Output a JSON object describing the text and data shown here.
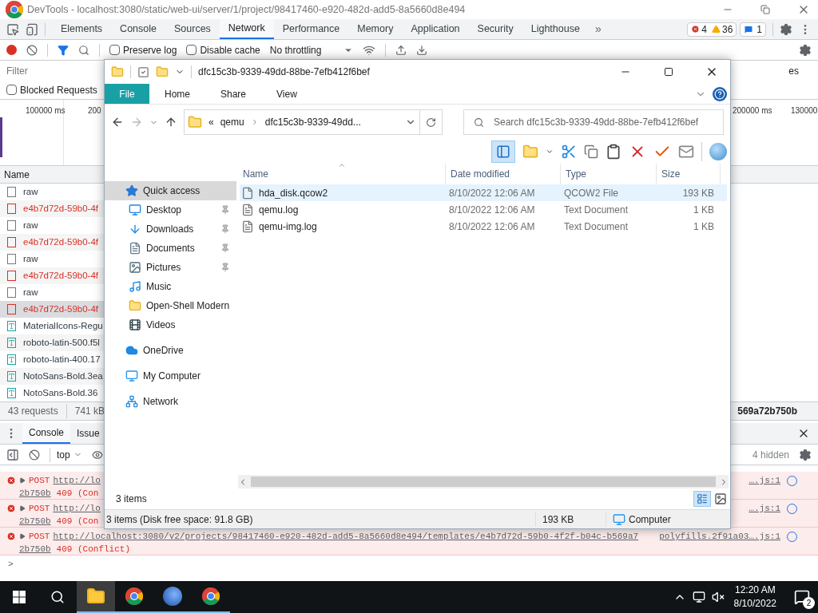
{
  "devtools": {
    "title": "DevTools - localhost:3080/static/web-ui/server/1/project/98417460-e920-482d-add5-8a5660d8e494",
    "tabs": [
      {
        "label": "Elements",
        "selected": false
      },
      {
        "label": "Console",
        "selected": false
      },
      {
        "label": "Sources",
        "selected": false
      },
      {
        "label": "Network",
        "selected": true
      },
      {
        "label": "Performance",
        "selected": false
      },
      {
        "label": "Memory",
        "selected": false
      },
      {
        "label": "Application",
        "selected": false
      },
      {
        "label": "Security",
        "selected": false
      },
      {
        "label": "Lighthouse",
        "selected": false
      }
    ],
    "more_tabs": "»",
    "badges": {
      "errors": "4",
      "warnings": "36",
      "messages": "1"
    },
    "recording": true,
    "preserve_log": {
      "label": "Preserve log",
      "checked": false
    },
    "disable_cache": {
      "label": "Disable cache",
      "checked": false
    },
    "throttling": "No throttling",
    "filter": {
      "placeholder": "Filter"
    },
    "filter_right": "es",
    "blocked_requests": {
      "label": "Blocked Requests",
      "checked": false
    },
    "timeline_ticks": [
      "100000 ms",
      "200",
      "200000 ms",
      "130000"
    ],
    "name_column": "Name",
    "requests": [
      {
        "name": "raw",
        "kind": "doc",
        "error": false,
        "selected": false
      },
      {
        "name": "e4b7d72d-59b0-4f",
        "kind": "doc",
        "error": true,
        "selected": false
      },
      {
        "name": "raw",
        "kind": "doc",
        "error": false,
        "selected": false
      },
      {
        "name": "e4b7d72d-59b0-4f",
        "kind": "doc",
        "error": true,
        "selected": false
      },
      {
        "name": "raw",
        "kind": "doc",
        "error": false,
        "selected": false
      },
      {
        "name": "e4b7d72d-59b0-4f",
        "kind": "doc",
        "error": true,
        "selected": false
      },
      {
        "name": "raw",
        "kind": "doc",
        "error": false,
        "selected": false
      },
      {
        "name": "e4b7d72d-59b0-4f",
        "kind": "doc",
        "error": true,
        "selected": true
      },
      {
        "name": "MaterialIcons-Regu",
        "kind": "font",
        "error": false,
        "selected": false
      },
      {
        "name": "roboto-latin-500.f5l",
        "kind": "font",
        "error": false,
        "selected": false
      },
      {
        "name": "roboto-latin-400.17",
        "kind": "font",
        "error": false,
        "selected": false
      },
      {
        "name": "NotoSans-Bold.3ea",
        "kind": "font",
        "error": false,
        "selected": false
      },
      {
        "name": "NotoSans-Bold.36",
        "kind": "font",
        "error": false,
        "selected": false
      }
    ],
    "summary": [
      "43 requests",
      "741 kB"
    ],
    "summary_right": "569a72b750b",
    "drawer_tabs": [
      {
        "label": "Console",
        "selected": true
      },
      {
        "label": "Issue",
        "selected": false
      }
    ],
    "context": "top",
    "hidden_count": "4 hidden",
    "messages": [
      {
        "method": "POST",
        "url": "http://lo",
        "url_cont": "2b750b",
        "status": "409 (Con",
        "source": "….js:1"
      },
      {
        "method": "POST",
        "url": "http://lo",
        "url_cont": "2b750b",
        "status": "409 (Con",
        "source": "….js:1"
      },
      {
        "method": "POST",
        "url": "http://localhost:3080/v2/projects/98417460-e920-482d-add5-8a5660d8e494/templates/e4b7d72d-59b0-4f2f-b04c-b569a7",
        "url_cont": "2b750b",
        "status": "409 (Conflict)",
        "source": "polyfills.2f91a03….js:1"
      }
    ],
    "prompt": ">"
  },
  "explorer": {
    "title": "dfc15c3b-9339-49dd-88be-7efb412f6bef",
    "ribbon_tabs": [
      {
        "label": "File",
        "kind": "file_menu"
      },
      {
        "label": "Home",
        "kind": "tab"
      },
      {
        "label": "Share",
        "kind": "tab"
      },
      {
        "label": "View",
        "kind": "tab"
      }
    ],
    "breadcrumb": [
      "«",
      "qemu",
      "dfc15c3b-9339-49dd..."
    ],
    "search": {
      "placeholder": "Search dfc15c3b-9339-49dd-88be-7efb412f6bef"
    },
    "nav": [
      {
        "label": "Quick access",
        "kind": "star",
        "selected": true,
        "children": [
          {
            "label": "Desktop",
            "kind": "desktop",
            "pinned": true
          },
          {
            "label": "Downloads",
            "kind": "downloads",
            "pinned": true
          },
          {
            "label": "Documents",
            "kind": "documents",
            "pinned": true
          },
          {
            "label": "Pictures",
            "kind": "pictures",
            "pinned": true
          },
          {
            "label": "Music",
            "kind": "music",
            "pinned": false
          },
          {
            "label": "Open-Shell Modern",
            "kind": "folder",
            "pinned": false
          },
          {
            "label": "Videos",
            "kind": "videos",
            "pinned": false
          }
        ]
      },
      {
        "label": "OneDrive",
        "kind": "cloud",
        "selected": false
      },
      {
        "label": "My Computer",
        "kind": "computer",
        "selected": false
      },
      {
        "label": "Network",
        "kind": "network",
        "selected": false
      }
    ],
    "columns": [
      "Name",
      "Date modified",
      "Type",
      "Size"
    ],
    "files": [
      {
        "name": "hda_disk.qcow2",
        "date": "8/10/2022 12:06 AM",
        "type": "QCOW2 File",
        "size": "193 KB",
        "kind": "blank",
        "selected": true
      },
      {
        "name": "qemu.log",
        "date": "8/10/2022 12:06 AM",
        "type": "Text Document",
        "size": "1 KB",
        "kind": "text",
        "selected": false
      },
      {
        "name": "qemu-img.log",
        "date": "8/10/2022 12:06 AM",
        "type": "Text Document",
        "size": "1 KB",
        "kind": "text",
        "selected": false
      }
    ],
    "item_count": "3 items",
    "status": {
      "info": "3 items (Disk free space: 91.8 GB)",
      "size": "193 KB",
      "location": "Computer"
    }
  },
  "taskbar": {
    "apps": [
      {
        "kind": "explorer",
        "selected": true
      },
      {
        "kind": "chrome",
        "selected": false
      },
      {
        "kind": "gns",
        "selected": false
      },
      {
        "kind": "chrome",
        "selected": false
      }
    ],
    "time": "12:20 AM",
    "date": "8/10/2022",
    "notifications": "2"
  }
}
